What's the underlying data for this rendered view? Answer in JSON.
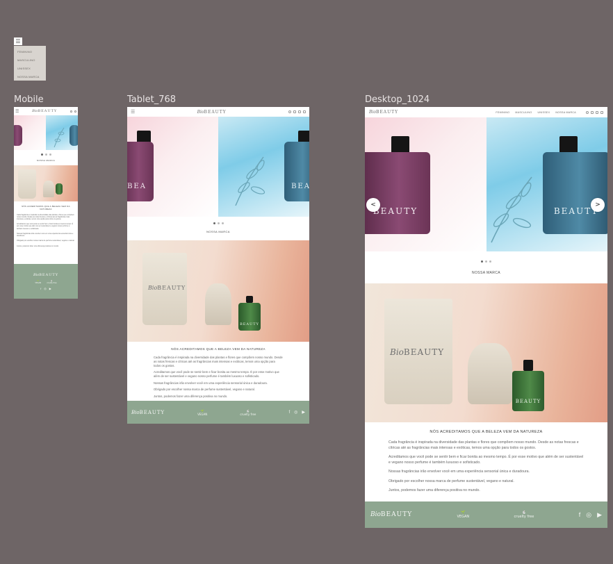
{
  "menu": {
    "button_icon": "☰",
    "items": [
      "FEMININO",
      "MASCULINO",
      "UNISSEX",
      "NOSSA MARCA"
    ]
  },
  "frames": {
    "mobile": "Mobile",
    "tablet": "Tablet_768",
    "desktop": "Desktop_1024"
  },
  "brand": {
    "script": "Bio",
    "caps": "BEAUTY"
  },
  "nav": [
    "FEMININO",
    "MASCULINO",
    "UNISSEX",
    "NOSSA MARCA"
  ],
  "hero": {
    "prev": "<",
    "next": ">"
  },
  "section": {
    "title": "NOSSA MARCA"
  },
  "about": {
    "title": "NÓS ACREDITAMOS QUE A BELEZA VEM DA NATUREZA",
    "p1": "Cada fragrância é inspirada na diversidade das plantas e flores que compõem nosso mundo. Desde as notas frescas e cítricas até as fragrâncias mais intensas e exóticas, temos uma opção para todos os gostos.",
    "p2": "Acreditamos que você pode se sentir bem e ficar bonita ao mesmo tempo. É por esse motivo que além de ser sustentável e vegano nosso perfume é também luxuoso e sofisticado.",
    "p3": "Nossas fragrâncias irão envolver você em uma experiência sensorial única e duradoura.",
    "p4": "Obrigado por escolher nossa marca de perfume sustentável, vegano e natural.",
    "p5": "Juntos, podemos fazer uma diferença positiva no mundo."
  },
  "footer": {
    "vegan": "VEGAN",
    "cruelty": "cruelty free"
  },
  "colors": {
    "background": "#6e6566",
    "footer": "#8ea690",
    "menu_panel": "#d8d4cf"
  }
}
